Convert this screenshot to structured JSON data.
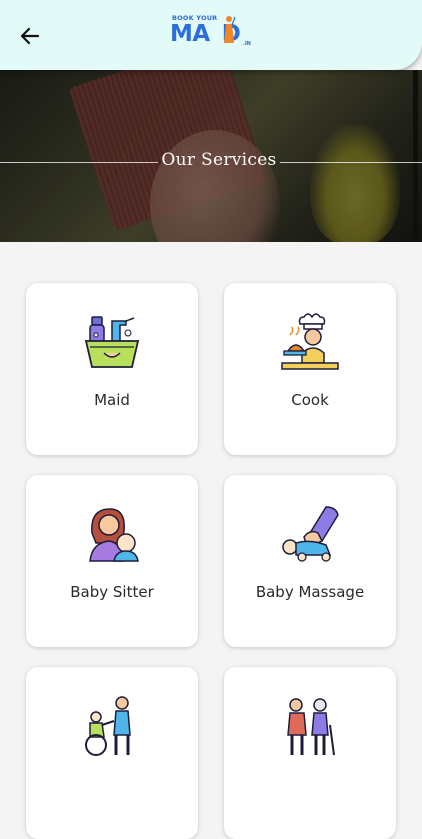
{
  "header": {
    "back_icon": "arrow-left-icon",
    "logo": {
      "top_text": "BOOK YOUR",
      "main_text_left": "MA",
      "main_text_right": "D",
      "suffix": ".IN"
    },
    "background_color": "#e2faf8"
  },
  "banner": {
    "title": "Our Services"
  },
  "services": [
    {
      "label": "Maid",
      "icon": "cleaning-basket-icon"
    },
    {
      "label": "Cook",
      "icon": "chef-icon"
    },
    {
      "label": "Baby Sitter",
      "icon": "mother-baby-icon"
    },
    {
      "label": "Baby Massage",
      "icon": "baby-massage-icon"
    },
    {
      "label": "",
      "icon": "wheelchair-caregiver-icon"
    },
    {
      "label": "",
      "icon": "elderly-care-icon"
    }
  ],
  "colors": {
    "brand_blue": "#2a6fdc",
    "brand_orange": "#f0882a",
    "page_background": "#f4f4f4",
    "card_background": "#ffffff"
  }
}
